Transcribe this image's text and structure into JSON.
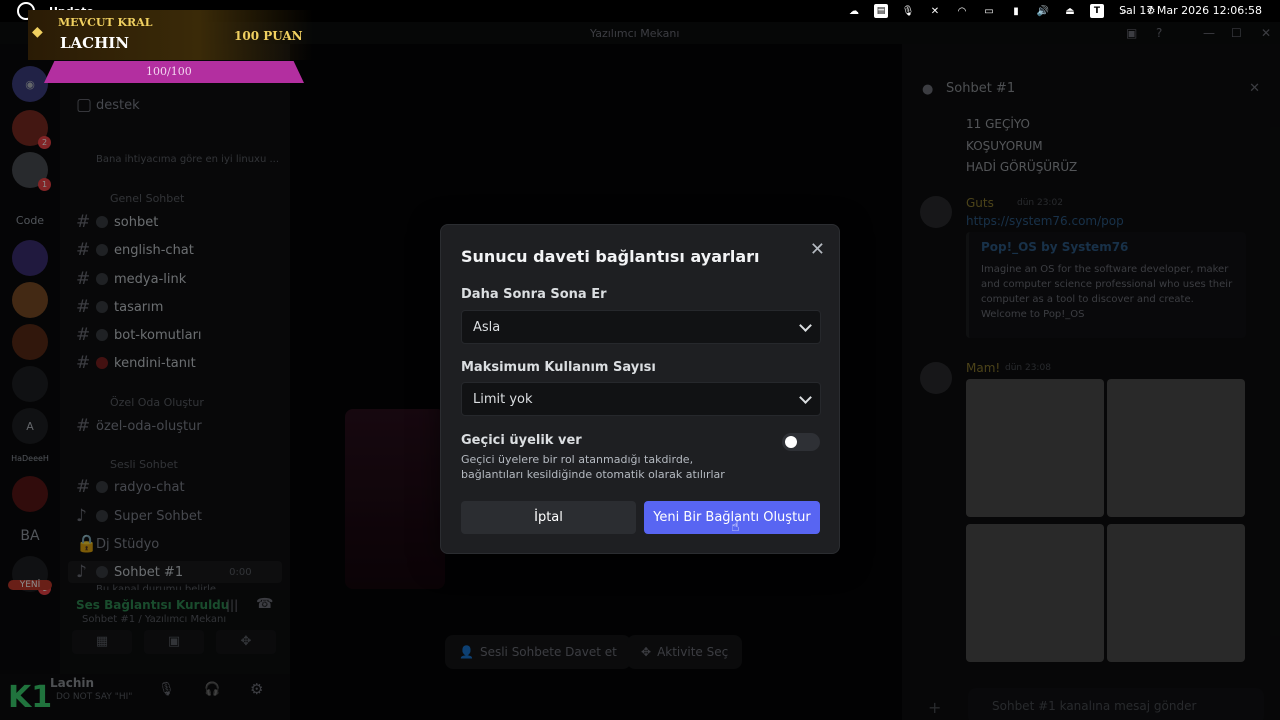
{
  "topbar": {
    "app_name": "Update",
    "clock": "Sal 17 Mar 2026 12:06:58",
    "tray_box_label": "T"
  },
  "overlay": {
    "rank": "MEVCUT KRAL",
    "user": "LACHIN",
    "points": "100 PUAN",
    "bar": "100/100"
  },
  "window": {
    "title": "Yazılımcı Mekanı"
  },
  "rail": {
    "code_label": "Code",
    "yapay_label": "HaDeeeH",
    "ba_label": "BA",
    "new_label": "YENİ",
    "badge_1": "2",
    "badge_2": "1",
    "badge_3": "1"
  },
  "channels": {
    "top_channel": "destek",
    "top_subtext": "Bana ihtiyacıma göre en iyi linuxu ...",
    "cat_general": "Genel Sohbet",
    "items_general": [
      {
        "name": "sohbet"
      },
      {
        "name": "english-chat"
      },
      {
        "name": "medya-link"
      },
      {
        "name": "tasarım"
      },
      {
        "name": "bot-komutları"
      },
      {
        "name": "kendini-tanıt"
      }
    ],
    "cat_private": "Özel Oda Oluştur",
    "private_channel": "özel-oda-oluştur",
    "cat_voice": "Sesli Sohbet",
    "voice_items": [
      {
        "name": "radyo-chat"
      },
      {
        "name": "Super Sohbet"
      },
      {
        "name": "Dj Stüdyo"
      },
      {
        "name": "Sohbet #1"
      }
    ],
    "voice_timer": "0:00",
    "voice_status": "Bu kanal durumu belirle"
  },
  "voice": {
    "status": "Ses Bağlantısı Kuruldu",
    "location": "Sohbet #1 / Yazılımcı Mekanı"
  },
  "user": {
    "name": "Lachin",
    "status": "DO NOT SAY \"HI\""
  },
  "center": {
    "invite_voice": "Sesli Sohbete Davet et",
    "activity": "Aktivite Seç"
  },
  "chat": {
    "channel": "Sohbet #1",
    "lines": [
      "11 GEÇİYO",
      "KOŞUYORUM",
      "HADİ GÖRÜŞÜRÜZ"
    ],
    "guts_name": "Guts",
    "guts_time": "dün 23:02",
    "guts_link": "https://system76.com/pop",
    "embed_title": "Pop!_OS by System76",
    "embed_desc": "Imagine an OS for the software developer, maker and computer science professional who uses their computer as a tool to discover and create. Welcome to Pop!_OS",
    "mami_name": "Mam!",
    "mami_time": "dün 23:08",
    "input_placeholder": "Sohbet #1 kanalına mesaj gönder"
  },
  "modal": {
    "title": "Sunucu daveti bağlantısı ayarları",
    "expire_label": "Daha Sonra Sona Er",
    "expire_value": "Asla",
    "max_uses_label": "Maksimum Kullanım Sayısı",
    "max_uses_value": "Limit yok",
    "temp_label": "Geçici üyelik ver",
    "temp_desc": "Geçici üyelere bir rol atanmadığı takdirde, bağlantıları kesildiğinde otomatik olarak atılırlar",
    "temp_enabled": false,
    "cancel": "İptal",
    "create": "Yeni Bir Bağlantı Oluştur"
  },
  "colors": {
    "accent": "#5865f2",
    "modal_bg": "#1e1f22",
    "overlay_bar": "#b32fa0",
    "gold": "#f0d060",
    "green": "#3bd16f"
  }
}
